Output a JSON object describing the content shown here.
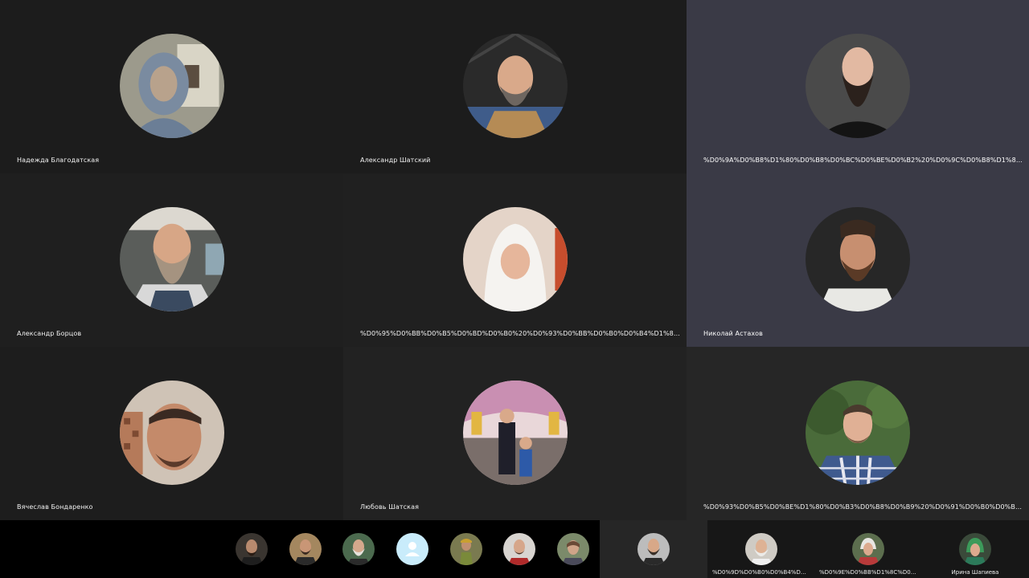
{
  "participants": [
    {
      "name": "Надежда Благодатская",
      "bg": "#1c1c1c"
    },
    {
      "name": "Александр Шатский",
      "bg": "#1c1c1c"
    },
    {
      "name": "%D0%9A%D0%B8%D1%80%D0%B8%D0%BC%D0%BE%D0%B2%20%D0%9C%D0%B8%D1%85%D0%B0%D0%B8...",
      "bg": "#3a3a46"
    },
    {
      "name": "Александр Борцов",
      "bg": "#1f1f1f"
    },
    {
      "name": "%D0%95%D0%BB%D0%B5%D0%BD%D0%B0%20%D0%93%D0%BB%D0%B0%D0%B4%D1%8B%D1%89%D1%83...",
      "bg": "#202020"
    },
    {
      "name": "Николай Астахов",
      "bg": "#3a3a46"
    },
    {
      "name": "Вячеслав Бондаренко",
      "bg": "#1d1d1d"
    },
    {
      "name": "Любовь Шатская",
      "bg": "#222222"
    },
    {
      "name": "%D0%93%D0%B5%D0%BE%D1%80%D0%B3%D0%B8%D0%B9%20%D0%91%D0%B0%D0%B9%D0%B4%D1%83...",
      "bg": "#262626"
    }
  ],
  "strip": {
    "thumbnails": [
      "user-1",
      "user-2",
      "user-3",
      "user-placeholder",
      "user-5",
      "user-6",
      "user-7"
    ],
    "tiles": [
      {
        "name": "",
        "bg": "#262626"
      },
      {
        "name": "%D0%9D%D0%B0%D0%B4%D1%83%D0%B8...",
        "bg": "#171717"
      },
      {
        "name": "%D0%9E%D0%BB%D1%8C%D0%B3%D0%B0...",
        "bg": "#171717"
      },
      {
        "name": "Ирина Шапиева",
        "bg": "#171717"
      }
    ]
  },
  "colors": {
    "tile_dark": "#1c1c1c",
    "tile_active": "#3a3a46",
    "strip_bg": "#000000",
    "placeholder_avatar": "#c9ecfb"
  }
}
